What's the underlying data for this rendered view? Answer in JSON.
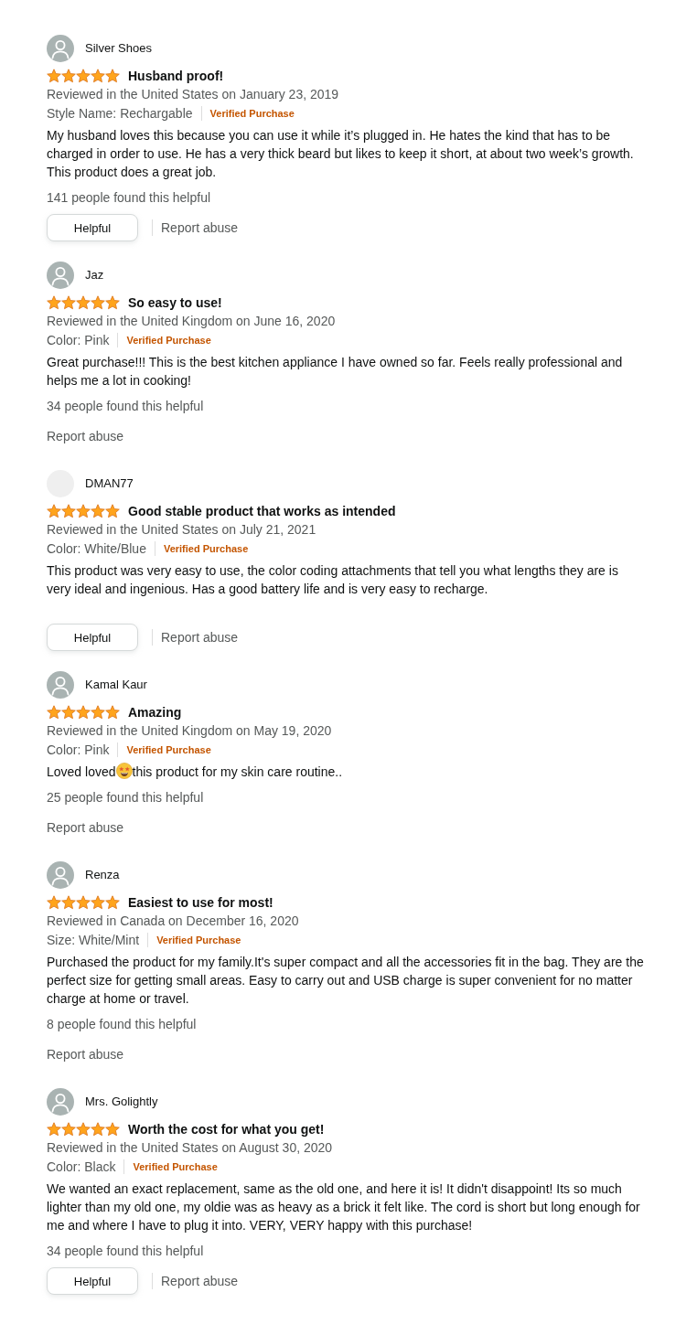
{
  "reviews": [
    {
      "avatar": {
        "kind": "silhouette"
      },
      "name": "Silver Shoes",
      "stars": 5,
      "title": "Husband proof!",
      "meta": "Reviewed in the United States on January 23, 2019",
      "variant": "Style Name: Rechargable",
      "badge": "Verified Purchase",
      "body": [
        {
          "kind": "text",
          "text": "My husband loves this because you can use it while it’s plugged in. He hates the kind that has to be charged in order to use. He has a very thick beard but likes to keep it short, at about two week’s growth. This product does a great job."
        }
      ],
      "helpful_count": "141 people found this helpful",
      "helpful_button": "Helpful",
      "report": "Report abuse"
    },
    {
      "avatar": {
        "kind": "silhouette"
      },
      "name": "Jaz",
      "stars": 5,
      "title": "So easy to use!",
      "meta": "Reviewed in the United Kingdom on June 16, 2020",
      "variant": "Color: Pink",
      "badge": "Verified Purchase",
      "body": [
        {
          "kind": "text",
          "text": "Great purchase!!! This is the best kitchen appliance I have owned so far. Feels really professional and helps me a lot in cooking!"
        }
      ],
      "helpful_count": "34 people found this helpful",
      "report": "Report abuse"
    },
    {
      "avatar": {
        "kind": "plain"
      },
      "name": "DMAN77",
      "stars": 5,
      "title": "Good stable product that works as intended",
      "meta": "Reviewed in the United States on July 21, 2021",
      "variant": "Color: White/Blue",
      "badge": "Verified Purchase",
      "body": [
        {
          "kind": "text",
          "text": "This product was very easy to use, the color coding attachments that tell you what lengths they are is very ideal and ingenious. Has a good battery life and is very easy to recharge."
        }
      ],
      "helpful_button": "Helpful",
      "report": "Report abuse"
    },
    {
      "avatar": {
        "kind": "silhouette"
      },
      "name": "Kamal Kaur",
      "stars": 5,
      "title": "Amazing",
      "meta": "Reviewed in the United Kingdom on May 19, 2020",
      "variant": "Color: Pink",
      "badge": "Verified Purchase",
      "body": [
        {
          "kind": "text",
          "text": "Loved loved"
        },
        {
          "kind": "emoji"
        },
        {
          "kind": "text",
          "text": "this product for my skin care routine.."
        }
      ],
      "helpful_count": "25 people found this helpful",
      "report": "Report abuse"
    },
    {
      "avatar": {
        "kind": "silhouette"
      },
      "name": "Renza",
      "stars": 5,
      "title": "Easiest to use for most!",
      "meta": "Reviewed in Canada on December 16, 2020",
      "variant": "Size: White/Mint",
      "badge": "Verified Purchase",
      "body": [
        {
          "kind": "text",
          "text": "Purchased the product for my family.It's super compact and all the accessories fit in the bag. They are the perfect size for getting small areas. Easy to carry out and USB charge is super convenient for no matter charge at home or travel."
        }
      ],
      "helpful_count": "8 people found this helpful",
      "report": "Report abuse"
    },
    {
      "avatar": {
        "kind": "silhouette"
      },
      "name": "Mrs. Golightly",
      "stars": 5,
      "title": "Worth the cost for what you get!",
      "meta": "Reviewed in the United States on August 30, 2020",
      "variant": "Color: Black",
      "badge": "Verified Purchase",
      "body": [
        {
          "kind": "text",
          "text": "We wanted an exact replacement, same as the old one, and here it is! It didn't disappoint! Its so much lighter than my old one, my oldie was as heavy as a brick it felt like. The cord is short but long enough for me and where I have to plug it into. VERY, VERY happy with this purchase!"
        }
      ],
      "helpful_count": "34 people found this helpful",
      "helpful_button": "Helpful",
      "report": "Report abuse"
    }
  ]
}
